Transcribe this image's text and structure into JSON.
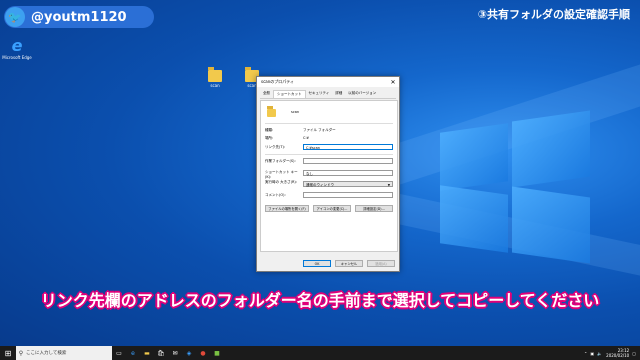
{
  "overlay": {
    "twitter_handle": "@youtm1120",
    "step_title": "③共有フォルダの設定確認手順",
    "caption": "リンク先欄のアドレスのフォルダー名の手前まで選択してコピーしてください"
  },
  "desktop": {
    "edge_label": "Microsoft Edge",
    "folder1_label": "scan",
    "folder2_label": "scan"
  },
  "dialog": {
    "title": "scanのプロパティ",
    "close": "✕",
    "tabs": [
      "全般",
      "ショートカット",
      "セキュリティ",
      "詳細",
      "以前のバージョン"
    ],
    "name_value": "scan",
    "rows": {
      "type_label": "種類:",
      "type_value": "ファイル フォルダー",
      "location_label": "場所:",
      "location_value": "C:¥",
      "target_label": "リンク先(T):",
      "target_value": "C:¥scan",
      "startin_label": "作業フォルダー(S):",
      "startin_value": "",
      "shortcut_label": "ショートカット キー(K):",
      "shortcut_value": "なし",
      "run_label": "実行時の 大きさ(R):",
      "run_value": "通常のウィンドウ",
      "comment_label": "コメント(O):",
      "comment_value": ""
    },
    "buttons": {
      "open_location": "ファイルの場所を開く(F)",
      "change_icon": "アイコンの変更(C)...",
      "advanced": "詳細設定(D)...",
      "ok": "OK",
      "cancel": "キャンセル",
      "apply": "適用(A)"
    }
  },
  "taskbar": {
    "search_placeholder": "ここに入力して検索",
    "time": "23:12",
    "date": "2020/02/10"
  }
}
